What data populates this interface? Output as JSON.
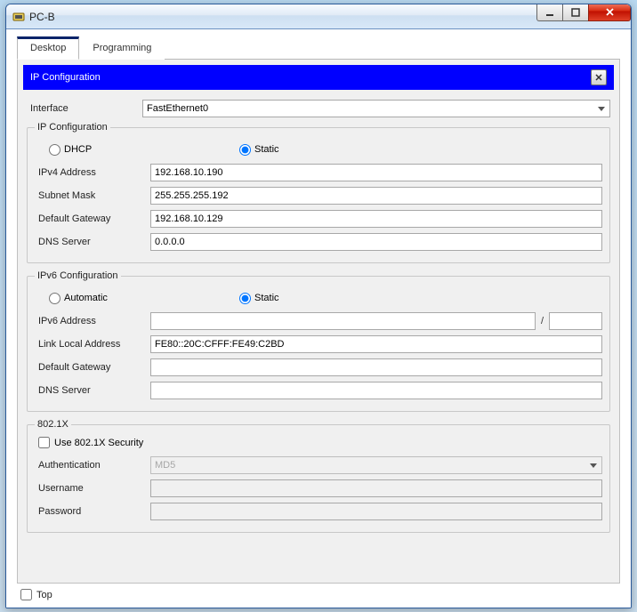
{
  "window": {
    "title": "PC-B"
  },
  "tabs": {
    "desktop": "Desktop",
    "programming": "Programming"
  },
  "panel": {
    "title": "IP Configuration"
  },
  "interface": {
    "label": "Interface",
    "value": "FastEthernet0"
  },
  "ipv4": {
    "legend": "IP Configuration",
    "dhcp": "DHCP",
    "static_label": "Static",
    "mode": "static",
    "ipv4_addr_label": "IPv4 Address",
    "ipv4_addr_value": "192.168.10.190",
    "subnet_label": "Subnet Mask",
    "subnet_value": "255.255.255.192",
    "gateway_label": "Default Gateway",
    "gateway_value": "192.168.10.129",
    "dns_label": "DNS Server",
    "dns_value": "0.0.0.0"
  },
  "ipv6": {
    "legend": "IPv6 Configuration",
    "auto_label": "Automatic",
    "static_label": "Static",
    "mode": "static",
    "ipv6_addr_label": "IPv6 Address",
    "ipv6_addr_value": "",
    "ipv6_prefix_value": "",
    "slash": "/",
    "linklocal_label": "Link Local Address",
    "linklocal_value": "FE80::20C:CFFF:FE49:C2BD",
    "gateway_label": "Default Gateway",
    "gateway_value": "",
    "dns_label": "DNS Server",
    "dns_value": ""
  },
  "dot1x": {
    "legend": "802.1X",
    "use_label": "Use 802.1X Security",
    "use_value": false,
    "auth_label": "Authentication",
    "auth_value": "MD5",
    "username_label": "Username",
    "username_value": "",
    "password_label": "Password",
    "password_value": ""
  },
  "footer": {
    "top_label": "Top",
    "top_value": false
  }
}
